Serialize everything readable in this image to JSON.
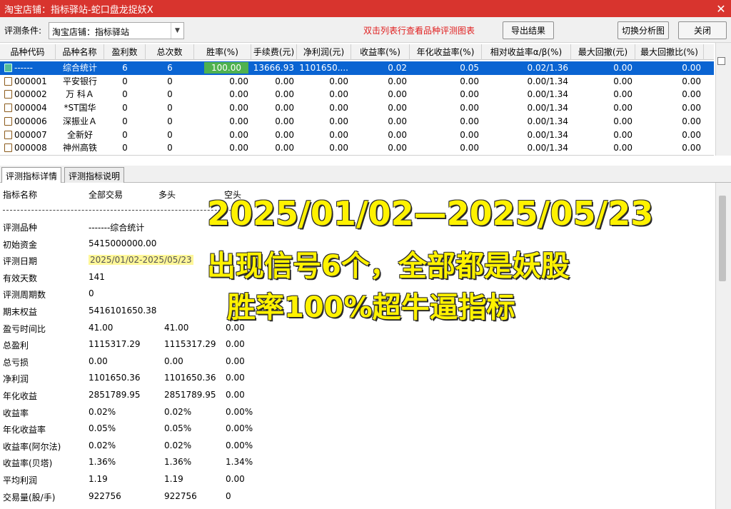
{
  "window": {
    "title": "淘宝店铺：指标驿站-蛇口盘龙捉妖X",
    "close_glyph": "✕"
  },
  "toolbar": {
    "criteria_label": "评测条件:",
    "criteria_value": "淘宝店铺：指标驿站",
    "hint": "双击列表行查看品种评测图表",
    "export_label": "导出结果",
    "switch_label": "切换分析图",
    "close_label": "关闭"
  },
  "grid": {
    "headers": [
      "品种代码",
      "品种名称",
      "盈利数",
      "总次数",
      "胜率(%)",
      "手续费(元)",
      "净利润(元)",
      "收益率(%)",
      "年化收益率(%)",
      "相对收益率α/β(%)",
      "最大回撤(元)",
      "最大回撤比(%)"
    ],
    "rows": [
      [
        "------",
        "综合统计",
        "6",
        "6",
        "100.00",
        "13666.93",
        "1101650....",
        "0.02",
        "0.05",
        "0.02/1.36",
        "0.00",
        "0.00"
      ],
      [
        "000001",
        "平安银行",
        "0",
        "0",
        "0.00",
        "0.00",
        "0.00",
        "0.00",
        "0.00",
        "0.00/1.34",
        "0.00",
        "0.00"
      ],
      [
        "000002",
        "万 科Ａ",
        "0",
        "0",
        "0.00",
        "0.00",
        "0.00",
        "0.00",
        "0.00",
        "0.00/1.34",
        "0.00",
        "0.00"
      ],
      [
        "000004",
        "*ST国华",
        "0",
        "0",
        "0.00",
        "0.00",
        "0.00",
        "0.00",
        "0.00",
        "0.00/1.34",
        "0.00",
        "0.00"
      ],
      [
        "000006",
        "深振业Ａ",
        "0",
        "0",
        "0.00",
        "0.00",
        "0.00",
        "0.00",
        "0.00",
        "0.00/1.34",
        "0.00",
        "0.00"
      ],
      [
        "000007",
        "全新好",
        "0",
        "0",
        "0.00",
        "0.00",
        "0.00",
        "0.00",
        "0.00",
        "0.00/1.34",
        "0.00",
        "0.00"
      ],
      [
        "000008",
        "神州高铁",
        "0",
        "0",
        "0.00",
        "0.00",
        "0.00",
        "0.00",
        "0.00",
        "0.00/1.34",
        "0.00",
        "0.00"
      ]
    ]
  },
  "tabs": [
    "评测指标详情",
    "评测指标说明"
  ],
  "details": {
    "headers": [
      "指标名称",
      "全部交易",
      "多头",
      "空头"
    ],
    "rows": [
      [
        "评测品种",
        "-------综合统计",
        "",
        ""
      ],
      [
        "初始资金",
        "5415000000.00",
        "",
        ""
      ],
      [
        "评测日期",
        "2025/01/02-2025/05/23",
        "",
        ""
      ],
      [
        "有效天数",
        "141",
        "",
        ""
      ],
      [
        "评测周期数",
        "0",
        "",
        ""
      ],
      [
        "期末权益",
        "5416101650.38",
        "",
        ""
      ],
      [
        "盈亏时间比",
        "41.00",
        "41.00",
        "0.00"
      ],
      [
        "总盈利",
        "1115317.29",
        "1115317.29",
        "0.00"
      ],
      [
        "总亏损",
        "0.00",
        "0.00",
        "0.00"
      ],
      [
        "净利润",
        "1101650.36",
        "1101650.36",
        "0.00"
      ],
      [
        "年化收益",
        "2851789.95",
        "2851789.95",
        "0.00"
      ],
      [
        "收益率",
        "0.02%",
        "0.02%",
        "0.00%"
      ],
      [
        "年化收益率",
        "0.05%",
        "0.05%",
        "0.00%"
      ],
      [
        "收益率(阿尔法)",
        "0.02%",
        "0.02%",
        "0.00%"
      ],
      [
        "收益率(贝塔)",
        "1.36%",
        "1.36%",
        "1.34%"
      ],
      [
        "平均利润",
        "1.19",
        "1.19",
        "0.00"
      ],
      [
        "交易量(股/手)",
        "922756",
        "922756",
        "0"
      ]
    ]
  },
  "overlay": {
    "line1": "2025/01/02—2025/05/23",
    "line2": "出现信号6个，全部都是妖股",
    "line3": "胜率100%超牛逼指标"
  },
  "colors": {
    "titlebar": "#d8342e",
    "selection": "#0a64d2",
    "win_highlight": "#4fb24f",
    "overlay_text": "#fff200",
    "hint_text": "#e02020"
  }
}
